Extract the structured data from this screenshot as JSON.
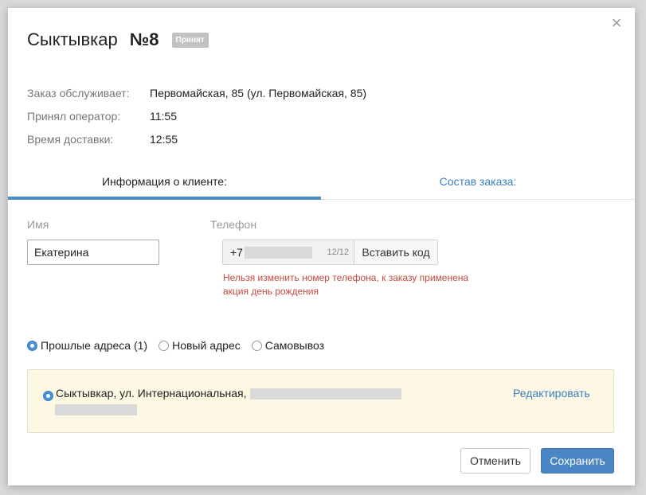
{
  "modal": {
    "close_label": "×",
    "title_city": "Сыктывкар",
    "title_number": "№8",
    "status_badge": "Принят"
  },
  "info": [
    {
      "label": "Заказ обслуживает:",
      "value": "Первомайская, 85 (ул. Первомайская, 85)"
    },
    {
      "label": "Принял оператор:",
      "value": "11:55"
    },
    {
      "label": "Время доставки:",
      "value": "12:55"
    }
  ],
  "tabs": {
    "client": "Информация о клиенте:",
    "order": "Состав заказа:"
  },
  "form": {
    "name_label": "Имя",
    "name_value": "Екатерина",
    "phone_label": "Телефон",
    "phone_prefix": "+7",
    "phone_counter": "12/12",
    "paste_code_label": "Вставить код",
    "phone_error": "Нельзя изменить номер телефона, к заказу применена акция день рождения"
  },
  "address_options": {
    "past": "Прошлые адреса (1)",
    "new": "Новый адрес",
    "pickup": "Самовывоз",
    "selected": "past"
  },
  "address": {
    "text": "Сыктывкар, ул. Интернациональная,",
    "edit_label": "Редактировать"
  },
  "footer": {
    "cancel_label": "Отменить",
    "save_label": "Сохранить"
  },
  "colors": {
    "accent": "#4a86c5",
    "link": "#3a7fc1",
    "error": "#c44a3f",
    "highlight_bg": "#fcf8e3",
    "badge_bg": "#c2c2c2"
  }
}
